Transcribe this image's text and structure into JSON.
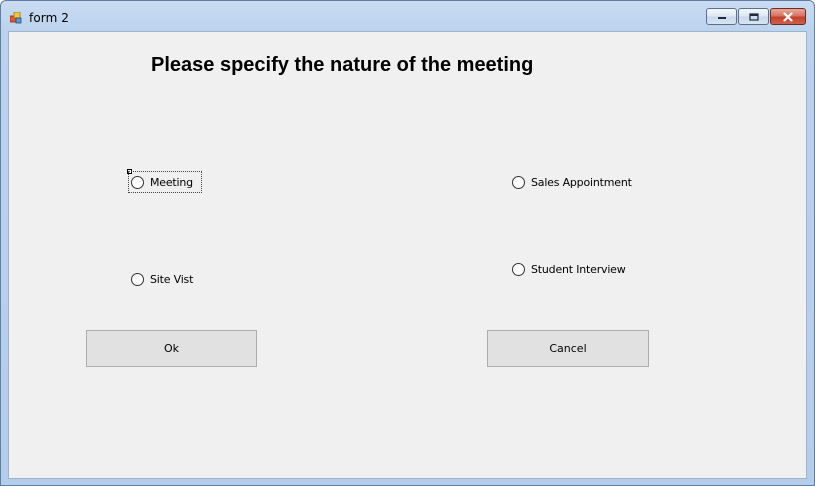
{
  "window": {
    "title": "form 2",
    "icon": "winforms-app-icon",
    "controls": [
      "minimize-icon",
      "maximize-icon",
      "close-icon"
    ]
  },
  "form": {
    "heading": "Please specify the nature of the meeting",
    "options": [
      {
        "label": "Meeting",
        "checked": false,
        "focused": true
      },
      {
        "label": "Sales Appointment",
        "checked": false
      },
      {
        "label": "Site Vist",
        "checked": false
      },
      {
        "label": "Student Interview",
        "checked": false
      }
    ],
    "buttons": {
      "ok": "Ok",
      "cancel": "Cancel"
    }
  },
  "colors": {
    "titlebar": "#bcd3ee",
    "client_bg": "#f0f0f0",
    "button_bg": "#e1e1e1",
    "close_button": "#c2412b"
  }
}
